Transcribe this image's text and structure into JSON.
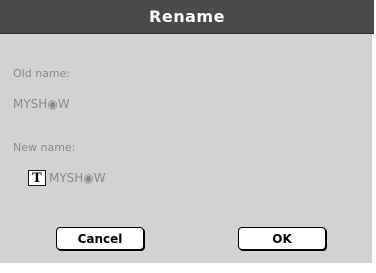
{
  "dialog": {
    "title": "Rename",
    "old_name_label": "Old name:",
    "old_name_value": "MYSH◉W",
    "new_name_label": "New name:",
    "new_name_value": "MYSH◉W",
    "text_edit_icon": "T",
    "cancel_label": "Cancel",
    "ok_label": "OK"
  },
  "colors": {
    "titlebar": "#4a4a4a",
    "panel": "#d2d2d2",
    "label_text": "#8a8a8a",
    "button_face": "#ffffff"
  }
}
